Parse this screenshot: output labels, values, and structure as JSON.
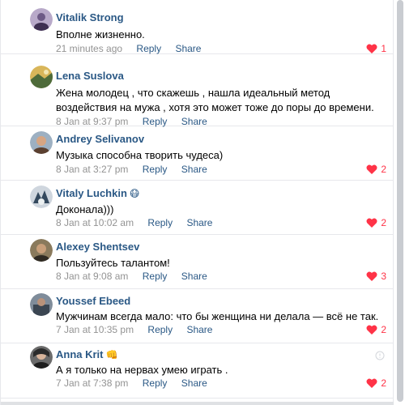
{
  "colors": {
    "author": "#2a5885",
    "meta": "#939393",
    "like": "#ff3347",
    "border": "#e7e8ec"
  },
  "comments": [
    {
      "author": "Vitalik Strong",
      "emoji": "",
      "text": "Вполне жизненно.",
      "date": "21 minutes ago",
      "reply": "Reply",
      "share": "Share",
      "likes": "1",
      "liked": true
    },
    {
      "author": "Lena Suslova",
      "emoji": "",
      "text": "Жена молодец , что скажешь , нашла идеальный метод воздействия на мужа , хотя это может тоже до поры до времени.",
      "date": "8 Jan at 9:37 pm",
      "reply": "Reply",
      "share": "Share",
      "likes": "",
      "liked": false
    },
    {
      "author": "Andrey Selivanov",
      "emoji": "",
      "text": "Музыка способна творить чудеса)",
      "date": "8 Jan at 3:27 pm",
      "reply": "Reply",
      "share": "Share",
      "likes": "2",
      "liked": true
    },
    {
      "author": "Vitaly Luchkin",
      "emoji": "😷",
      "text": "Доконала)))",
      "date": "8 Jan at 10:02 am",
      "reply": "Reply",
      "share": "Share",
      "likes": "2",
      "liked": true
    },
    {
      "author": "Alexey Shentsev",
      "emoji": "",
      "text": "Пользуйтесь талантом!",
      "date": "8 Jan at 9:08 am",
      "reply": "Reply",
      "share": "Share",
      "likes": "3",
      "liked": true
    },
    {
      "author": "Youssef Ebeed",
      "emoji": "",
      "text": "Мужчинам всегда мало: что бы женщина ни делала — всё не так.",
      "date": "7 Jan at 10:35 pm",
      "reply": "Reply",
      "share": "Share",
      "likes": "2",
      "liked": true
    },
    {
      "author": "Anna Krit",
      "emoji": "👊",
      "text": "А я только на нервах умею играть .",
      "date": "7 Jan at 7:38 pm",
      "reply": "Reply",
      "share": "Share",
      "likes": "2",
      "liked": true
    }
  ]
}
